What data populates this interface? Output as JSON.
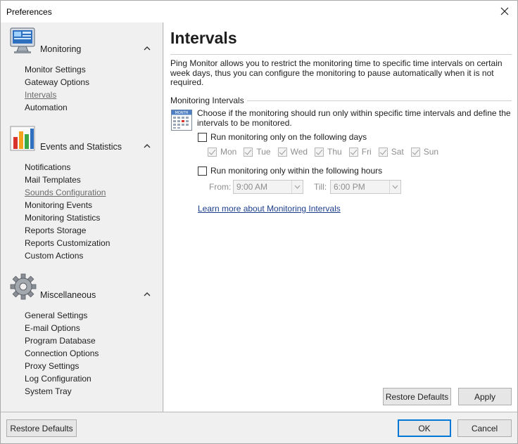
{
  "window": {
    "title": "Preferences"
  },
  "sidebar": {
    "groups": [
      {
        "title": "Monitoring",
        "icon": "monitor-icon",
        "items": [
          "Monitor Settings",
          "Gateway Options",
          "Intervals",
          "Automation"
        ]
      },
      {
        "title": "Events and Statistics",
        "icon": "bar-chart-icon",
        "items": [
          "Notifications",
          "Mail Templates",
          "Sounds Configuration",
          "Monitoring Events",
          "Monitoring Statistics",
          "Reports Storage",
          "Reports Customization",
          "Custom Actions"
        ]
      },
      {
        "title": "Miscellaneous",
        "icon": "gear-icon",
        "items": [
          "General Settings",
          "E-mail Options",
          "Program Database",
          "Connection Options",
          "Proxy Settings",
          "Log Configuration",
          "System Tray"
        ]
      }
    ],
    "selected_item": "Intervals"
  },
  "content": {
    "title": "Intervals",
    "description": "Ping Monitor allows you to restrict the monitoring time to specific time intervals on certain week days, thus you can configure the monitoring to pause automatically when it is not required.",
    "section_label": "Monitoring Intervals",
    "calendar_icon_text": "MONTH",
    "choose_text": "Choose if the monitoring should run only within specific time intervals and define the intervals to be monitored.",
    "days_option": {
      "label": "Run monitoring only on the following days",
      "checked": false
    },
    "days": [
      {
        "label": "Mon",
        "checked": true
      },
      {
        "label": "Tue",
        "checked": true
      },
      {
        "label": "Wed",
        "checked": true
      },
      {
        "label": "Thu",
        "checked": true
      },
      {
        "label": "Fri",
        "checked": true
      },
      {
        "label": "Sat",
        "checked": true
      },
      {
        "label": "Sun",
        "checked": true
      }
    ],
    "hours_option": {
      "label": "Run monitoring only within the following hours",
      "checked": false
    },
    "from_label": "From:",
    "from_value": "9:00 AM",
    "till_label": "Till:",
    "till_value": "6:00 PM",
    "learn_more": "Learn more about Monitoring Intervals",
    "restore_defaults": "Restore Defaults",
    "apply": "Apply"
  },
  "footer": {
    "restore_defaults": "Restore Defaults",
    "ok": "OK",
    "cancel": "Cancel"
  },
  "colors": {
    "link": "#1c3e8a",
    "default_button_border": "#0078d7",
    "sidebar_bg": "#f0f0f0"
  }
}
